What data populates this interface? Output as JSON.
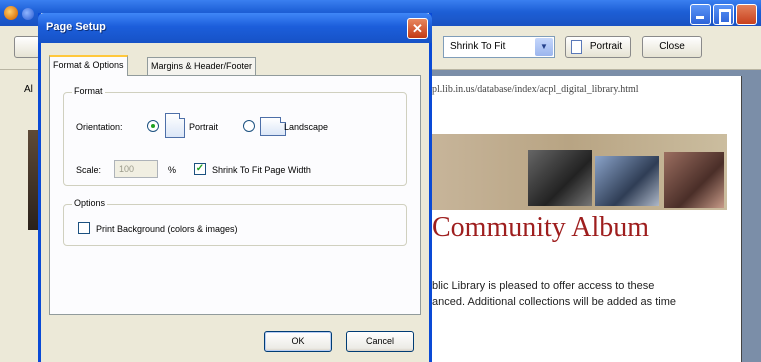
{
  "background": {
    "url": "pl.lib.in.us/database/index/acpl_digital_library.html",
    "album_title": "Community Album",
    "paragraph_line_1": "blic Library is pleased to offer access to these",
    "paragraph_line_2": "anced. Additional collections will be added as time",
    "sidebar_label": "Al"
  },
  "toolbar": {
    "zoom_value": "Shrink To Fit",
    "portrait_label": "Portrait",
    "close_label": "Close"
  },
  "dialog": {
    "title": "Page Setup",
    "close_glyph": "✕",
    "tabs": [
      {
        "label": "Format & Options",
        "selected": true
      },
      {
        "label": "Margins & Header/Footer",
        "selected": false
      }
    ],
    "format": {
      "group_label": "Format",
      "orientation_label": "Orientation:",
      "portrait_label": "Portrait",
      "landscape_label": "Landscape",
      "orientation_selected": "portrait",
      "scale_label": "Scale:",
      "scale_value": "100",
      "scale_unit": "%",
      "shrink_label": "Shrink To Fit Page Width",
      "shrink_checked": true
    },
    "options": {
      "group_label": "Options",
      "print_background_label": "Print Background (colors & images)",
      "print_background_checked": false
    },
    "ok_label": "OK",
    "cancel_label": "Cancel"
  },
  "colors": {
    "xp_title_blue": "#1d5fd6",
    "dialog_face": "#ece9d8",
    "album_red": "#9e1e1e"
  }
}
